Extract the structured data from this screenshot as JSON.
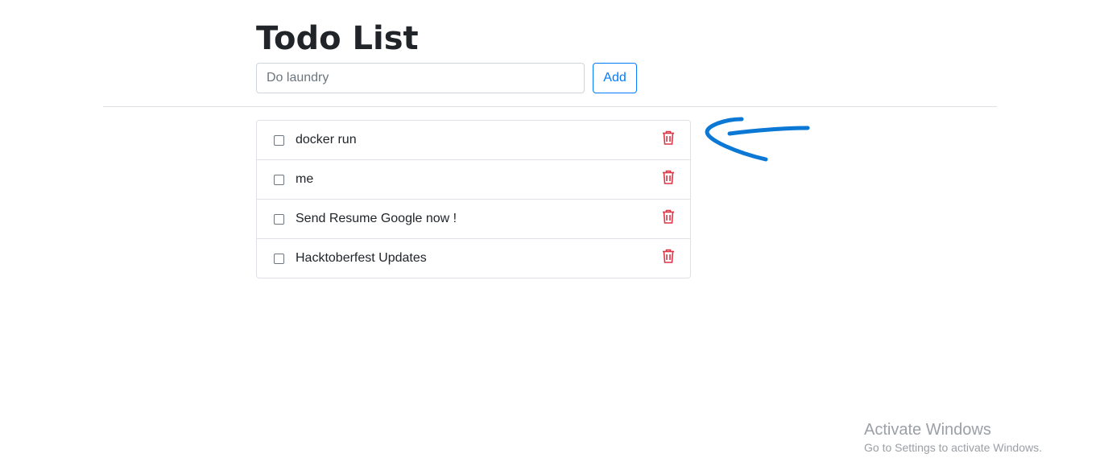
{
  "page": {
    "title": "Todo List"
  },
  "form": {
    "placeholder": "Do laundry",
    "value": "",
    "add_label": "Add"
  },
  "todos": [
    {
      "text": "docker run",
      "checked": false
    },
    {
      "text": "me",
      "checked": false
    },
    {
      "text": "Send Resume Google now !",
      "checked": false
    },
    {
      "text": "Hacktoberfest Updates",
      "checked": false
    }
  ],
  "icons": {
    "delete": "trash-icon",
    "annotation": "hand-drawn-arrow-icon"
  },
  "colors": {
    "primary": "#007bff",
    "danger": "#dc3545",
    "annotation": "#0a78d4"
  },
  "watermark": {
    "title": "Activate Windows",
    "subtitle": "Go to Settings to activate Windows."
  }
}
